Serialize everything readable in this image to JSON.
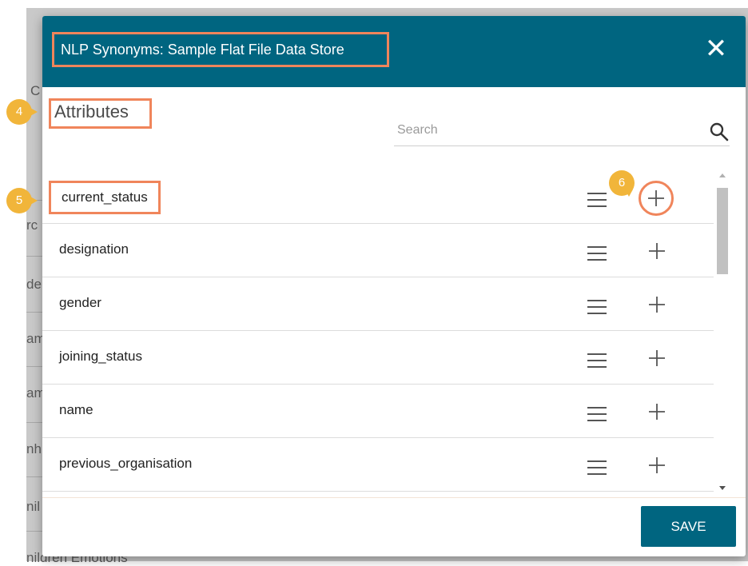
{
  "dialog": {
    "title": "NLP Synonyms: Sample Flat File Data Store",
    "close_symbol": "✕",
    "heading": "Attributes",
    "search_placeholder": "Search",
    "save_label": "SAVE"
  },
  "attributes": [
    {
      "name": "current_status"
    },
    {
      "name": "designation"
    },
    {
      "name": "gender"
    },
    {
      "name": "joining_status"
    },
    {
      "name": "name"
    },
    {
      "name": "previous_organisation"
    }
  ],
  "markers": [
    "4",
    "5",
    "6"
  ],
  "background_fragments": [
    "C",
    "rc",
    "de",
    "am",
    "am",
    "nh",
    "nil",
    "nildren Emotions"
  ],
  "colors": {
    "header": "#006580",
    "highlight": "#f0855b",
    "marker": "#f1b53a",
    "save": "#006580"
  }
}
